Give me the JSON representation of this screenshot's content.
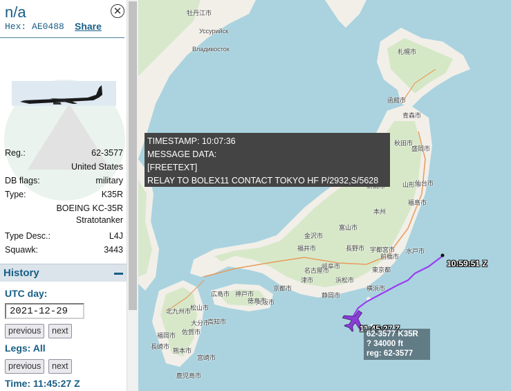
{
  "sidebar": {
    "callsign": "n/a",
    "hex_label": "Hex:",
    "hex": "AE0488",
    "share": "Share",
    "close_icon": "close-circle-icon",
    "details": [
      {
        "key": "Reg.:",
        "value": "62-3577"
      },
      {
        "key": "",
        "value": "United States"
      },
      {
        "key": "DB flags:",
        "value": "military"
      },
      {
        "key": "Type:",
        "value": "K35R"
      },
      {
        "key": "",
        "value": "BOEING KC-35R"
      },
      {
        "key": "",
        "value": "Stratotanker"
      },
      {
        "key": "Type Desc.:",
        "value": "L4J"
      },
      {
        "key": "Squawk:",
        "value": "3443"
      }
    ],
    "history": {
      "title": "History",
      "utc_day_label": "UTC day:",
      "date": "2021-12-29",
      "previous": "previous",
      "next": "next",
      "legs_label": "Legs: All",
      "legs_previous": "previous",
      "legs_next": "next",
      "time_label": "Time: 11:45:27 Z"
    }
  },
  "map": {
    "tooltip": {
      "lines": [
        "TIMESTAMP: 10:07:36",
        "MESSAGE DATA:",
        "[FREETEXT]",
        "RELAY TO BOLEX11 CONTACT TOKYO HF P/2932,S/5628"
      ]
    },
    "track_end_time": "10:59:51 Z",
    "aircraft_time": "11:45:27 Z",
    "aircraft_label": {
      "line1": "62-3577 K35R",
      "line2": "?   34000 ft",
      "line3": "reg: 62-3577"
    },
    "track_color": "#9b3cf0",
    "aircraft_icon": "airplane-icon",
    "places": [
      {
        "name": "牡丹江市"
      },
      {
        "name": "Уссурийск"
      },
      {
        "name": "Владивосток"
      },
      {
        "name": "札幌市"
      },
      {
        "name": "函館市"
      },
      {
        "name": "青森市"
      },
      {
        "name": "秋田市"
      },
      {
        "name": "盛岡市"
      },
      {
        "name": "山形市"
      },
      {
        "name": "仙台市"
      },
      {
        "name": "新潟市"
      },
      {
        "name": "本州"
      },
      {
        "name": "福島市"
      },
      {
        "name": "富山市"
      },
      {
        "name": "金沢市"
      },
      {
        "name": "長野市"
      },
      {
        "name": "宇都宮市"
      },
      {
        "name": "福井市"
      },
      {
        "name": "前橋市"
      },
      {
        "name": "水戸市"
      },
      {
        "name": "岐阜市"
      },
      {
        "name": "名古屋市"
      },
      {
        "name": "東京都"
      },
      {
        "name": "横浜市"
      },
      {
        "name": "静岡市"
      },
      {
        "name": "京都市"
      },
      {
        "name": "大阪市"
      },
      {
        "name": "神戸市"
      },
      {
        "name": "広島市"
      },
      {
        "name": "松山市"
      },
      {
        "name": "高知市"
      },
      {
        "name": "徳島市"
      },
      {
        "name": "北九州市"
      },
      {
        "name": "福岡市"
      },
      {
        "name": "佐賀市"
      },
      {
        "name": "大分市"
      },
      {
        "name": "熊本市"
      },
      {
        "name": "長崎市"
      },
      {
        "name": "宮崎市"
      },
      {
        "name": "鹿児島市"
      },
      {
        "name": "浜松市"
      },
      {
        "name": "津市"
      }
    ]
  }
}
